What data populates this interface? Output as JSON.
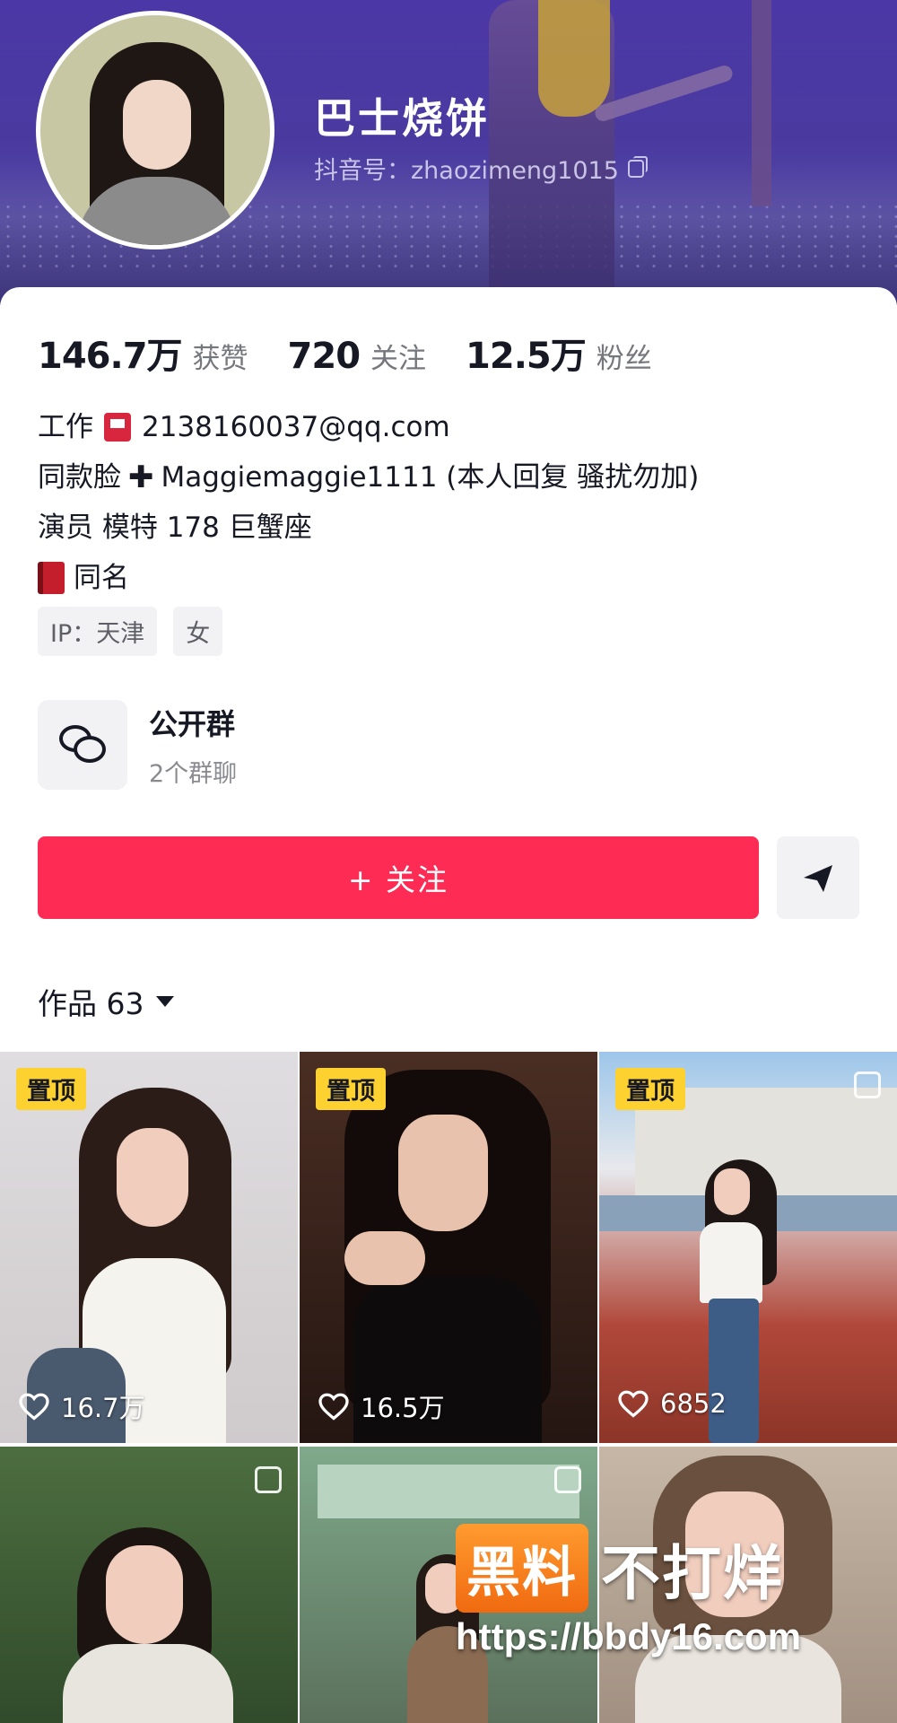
{
  "profile": {
    "nickname": "巴士烧饼",
    "douyin_id": "抖音号：zhaozimeng1015"
  },
  "stats": [
    {
      "value": "146.7万",
      "label": "获赞"
    },
    {
      "value": "720",
      "label": "关注"
    },
    {
      "value": "12.5万",
      "label": "粉丝"
    }
  ],
  "bio": {
    "line1_prefix": "工作",
    "line1_email": "2138160037@qq.com",
    "line2_prefix": "同款脸",
    "line2_text": "Maggiemaggie1111 (本人回复 骚扰勿加)",
    "line3": "演员 模特 178 巨蟹座",
    "line4": "同名"
  },
  "tags": [
    "IP：天津",
    "女"
  ],
  "group": {
    "title": "公开群",
    "subtitle": "2个群聊"
  },
  "actions": {
    "follow_label": "+ 关注"
  },
  "works": {
    "tab_label": "作品 63"
  },
  "videos": [
    {
      "pinned_label": "置顶",
      "likes": "16.7万"
    },
    {
      "pinned_label": "置顶",
      "likes": "16.5万"
    },
    {
      "pinned_label": "置顶",
      "likes": "6852"
    },
    {
      "likes": ""
    },
    {
      "likes": ""
    },
    {
      "likes": ""
    }
  ],
  "watermark": {
    "logo": "黑料",
    "text": "不打烊",
    "url": "https://bbdy16.com"
  },
  "colors": {
    "accent": "#fe2c55",
    "pin_badge": "#fdd230",
    "banner": "#4b38a6"
  }
}
